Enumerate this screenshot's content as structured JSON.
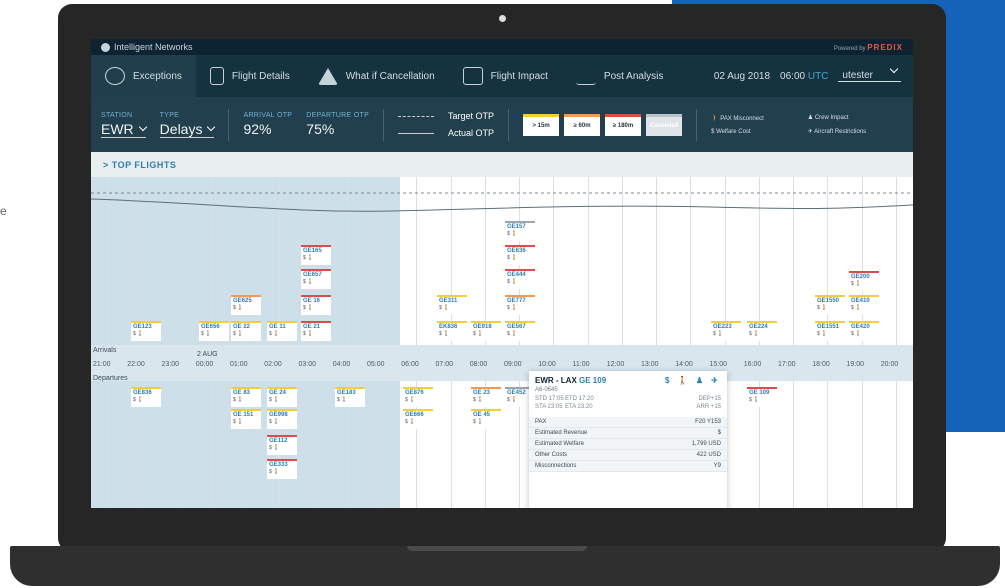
{
  "page": {
    "side_text": "e"
  },
  "app": {
    "brand": "Intelligent Networks",
    "powered_by": "Powered by",
    "predix": "PREDIX"
  },
  "nav": {
    "items": [
      {
        "label": "Exceptions"
      },
      {
        "label": "Flight Details"
      },
      {
        "label": "What if Cancellation"
      },
      {
        "label": "Flight Impact"
      },
      {
        "label": "Post Analysis"
      }
    ],
    "date": "02 Aug 2018",
    "time": "06:00",
    "tz": "UTC",
    "user": "utester"
  },
  "filters": {
    "station_label": "STATION",
    "station": "EWR",
    "type_label": "TYPE",
    "type": "Delays",
    "arrival_otp_label": "ARRIVAL OTP",
    "arrival_otp": "92%",
    "departure_otp_label": "DEPARTURE OTP",
    "departure_otp": "75%",
    "target_otp": "Target OTP",
    "actual_otp": "Actual OTP"
  },
  "legend": {
    "items": [
      {
        "label": "> 15m"
      },
      {
        "label": "≥ 60m"
      },
      {
        "label": "≥ 180m"
      },
      {
        "label": "Cancelled"
      }
    ]
  },
  "impact": {
    "pax": "PAX Misconnect",
    "welfare": "Welfare Cost",
    "crew": "Crew Impact",
    "aircraft": "Aircraft Restrictions"
  },
  "section": {
    "top_flights": "> TOP FLIGHTS"
  },
  "axis": {
    "arrivals": "Arrivals",
    "departures": "Departures",
    "date": "2 AUG",
    "ticks": [
      "21:00",
      "22:00",
      "23:00",
      "00:00",
      "01:00",
      "02:00",
      "03:00",
      "04:00",
      "05:00",
      "06:00",
      "07:00",
      "08:00",
      "09:00",
      "10:00",
      "11:00",
      "12:00",
      "13:00",
      "14:00",
      "15:00",
      "16:00",
      "17:00",
      "18:00",
      "19:00",
      "20:00"
    ]
  },
  "arrivals": [
    "GE123",
    "GE656",
    "GE 22",
    "GE 11",
    "GE 21",
    "GE625",
    "GE 16",
    "GE657",
    "GE165",
    "EK836",
    "GE918",
    "GE567",
    "GE311",
    "GE777",
    "GE444",
    "GE636",
    "GE157",
    "GE223",
    "GE224",
    "GE1551",
    "GE420",
    "GE1550",
    "GE410",
    "GE200"
  ],
  "departures": [
    "GE836",
    "GE 83",
    "GE 24",
    "GE 151",
    "GE998",
    "GE112",
    "GE333",
    "GE183",
    "GE876",
    "GE666",
    "GE 23",
    "GE 45",
    "GE452",
    "GE 109"
  ],
  "popup": {
    "route": "EWR - LAX",
    "flight": "GE 109",
    "tail": "A6-0645",
    "std_label": "STD 17:05",
    "etd_label": "ETD 17:20",
    "dep_delay": "DEP+15",
    "sta_label": "STA 23:05",
    "eta_label": "ETA 23:20",
    "arr_delay": "ARR +15",
    "rows": [
      {
        "k": "PAX",
        "v": "F20 Y153"
      },
      {
        "k": "Estimated Revenue",
        "v": "$"
      },
      {
        "k": "Estimated Welfare",
        "v": "1,799 USD"
      },
      {
        "k": "Other Costs",
        "v": "422 USD"
      },
      {
        "k": "Misconnections",
        "v": "Y9"
      }
    ]
  }
}
